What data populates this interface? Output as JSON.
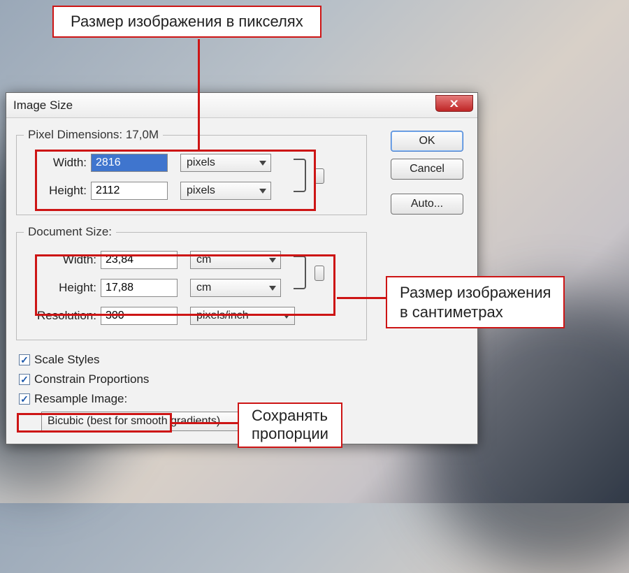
{
  "callouts": {
    "top": "Размер изображения в пикселях",
    "right_l1": "Размер изображения",
    "right_l2": "в сантиметрах",
    "bottom_l1": "Сохранять",
    "bottom_l2": "пропорции"
  },
  "dialog": {
    "title": "Image Size",
    "close_x": "X"
  },
  "pixel_dimensions": {
    "legend": "Pixel Dimensions:  17,0M",
    "width_label": "Width:",
    "width_value": "2816",
    "width_unit": "pixels",
    "height_label": "Height:",
    "height_value": "2112",
    "height_unit": "pixels"
  },
  "document_size": {
    "legend": "Document Size:",
    "width_label": "Width:",
    "width_value": "23,84",
    "width_unit": "cm",
    "height_label": "Height:",
    "height_value": "17,88",
    "height_unit": "cm",
    "resolution_label": "Resolution:",
    "resolution_value": "300",
    "resolution_unit": "pixels/inch"
  },
  "buttons": {
    "ok": "OK",
    "cancel": "Cancel",
    "auto": "Auto..."
  },
  "checks": {
    "scale_styles": "Scale Styles",
    "constrain": "Constrain Proportions",
    "resample": "Resample Image:"
  },
  "resample_method": "Bicubic (best for smooth gradients)",
  "colors": {
    "annotation": "#d11"
  }
}
